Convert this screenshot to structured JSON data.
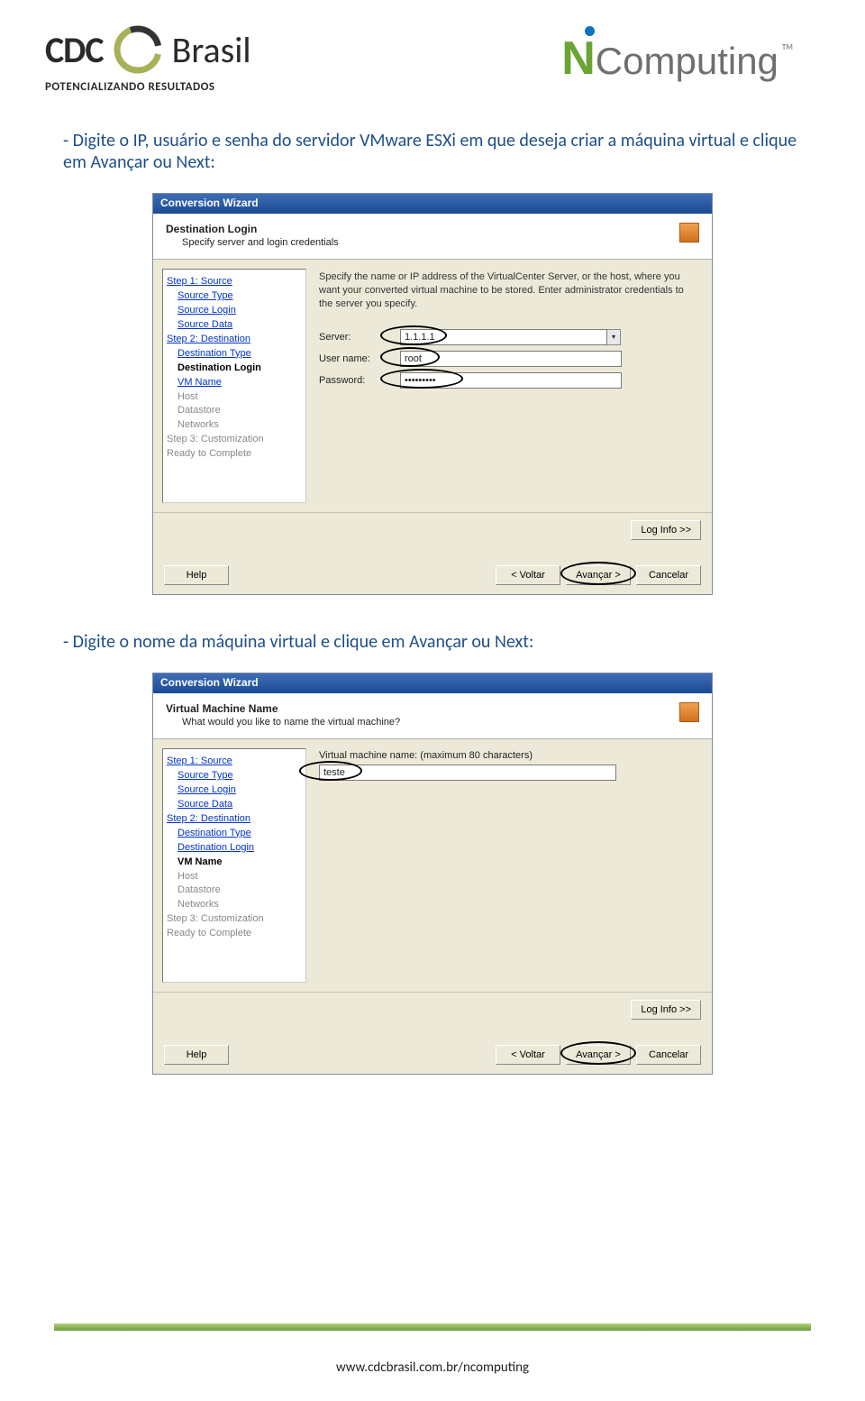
{
  "header": {
    "cdc": "CDC",
    "brasil": "Brasil",
    "tagline": "POTENCIALIZANDO RESULTADOS",
    "nc_n": "N",
    "nc_rest": "Computing",
    "nc_tm": "TM"
  },
  "instruction1": "- Digite o IP, usuário e senha do servidor VMware ESXi em que deseja criar a máquina virtual e clique em Avançar ou Next:",
  "instruction2": "- Digite o nome da máquina virtual e clique em Avançar ou Next:",
  "wizard1": {
    "titlebar": "Conversion Wizard",
    "title": "Destination Login",
    "subtitle": "Specify server and login credentials",
    "desc": "Specify the name or IP address of the VirtualCenter Server, or the host, where you want your converted virtual machine to be stored. Enter administrator credentials to the server you specify.",
    "labels": {
      "server": "Server:",
      "user": "User name:",
      "pass": "Password:"
    },
    "values": {
      "server": "1.1.1.1",
      "user": "root",
      "pass": "*********"
    },
    "steps": {
      "s1": "Step 1: Source",
      "s1a": "Source Type",
      "s1b": "Source Login",
      "s1c": "Source Data",
      "s2": "Step 2: Destination",
      "s2a": "Destination Type",
      "s2b": "Destination Login",
      "s2c": "VM Name",
      "s2d": "Host",
      "s2e": "Datastore",
      "s2f": "Networks",
      "s3": "Step 3: Customization",
      "s4": "Ready to Complete"
    },
    "buttons": {
      "loginfo": "Log Info >>",
      "help": "Help",
      "back": "< Voltar",
      "next": "Avançar >",
      "cancel": "Cancelar"
    }
  },
  "wizard2": {
    "titlebar": "Conversion Wizard",
    "title": "Virtual Machine Name",
    "subtitle": "What would you like to name the virtual machine?",
    "namelabel": "Virtual machine name: (maximum 80 characters)",
    "namevalue": "teste",
    "steps": {
      "s1": "Step 1: Source",
      "s1a": "Source Type",
      "s1b": "Source Login",
      "s1c": "Source Data",
      "s2": "Step 2: Destination",
      "s2a": "Destination Type",
      "s2b": "Destination Login",
      "s2c": "VM Name",
      "s2d": "Host",
      "s2e": "Datastore",
      "s2f": "Networks",
      "s3": "Step 3: Customization",
      "s4": "Ready to Complete"
    },
    "buttons": {
      "loginfo": "Log Info >>",
      "help": "Help",
      "back": "< Voltar",
      "next": "Avançar >",
      "cancel": "Cancelar"
    }
  },
  "footer_url": "www.cdcbrasil.com.br/ncomputing"
}
